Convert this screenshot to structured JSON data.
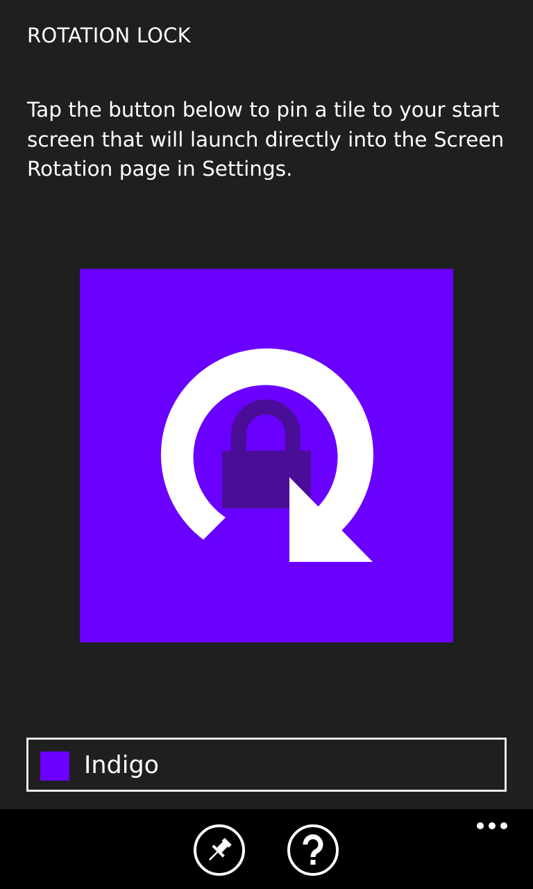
{
  "header": {
    "title": "ROTATION LOCK"
  },
  "main": {
    "description": "Tap the button below to pin a tile to your start screen that will launch directly into the Screen Rotation page in Settings.",
    "tile": {
      "background_color": "#6a00ff",
      "arrow_color": "#ffffff",
      "lock_color": "#4a0d98",
      "icon": "rotation-lock-icon"
    }
  },
  "color_picker": {
    "selected_label": "Indigo",
    "selected_color": "#6a00ff"
  },
  "app_bar": {
    "buttons": [
      {
        "icon": "pin-icon",
        "action": "pin"
      },
      {
        "icon": "help-icon",
        "action": "help"
      }
    ],
    "more_icon": "ellipsis-icon"
  }
}
